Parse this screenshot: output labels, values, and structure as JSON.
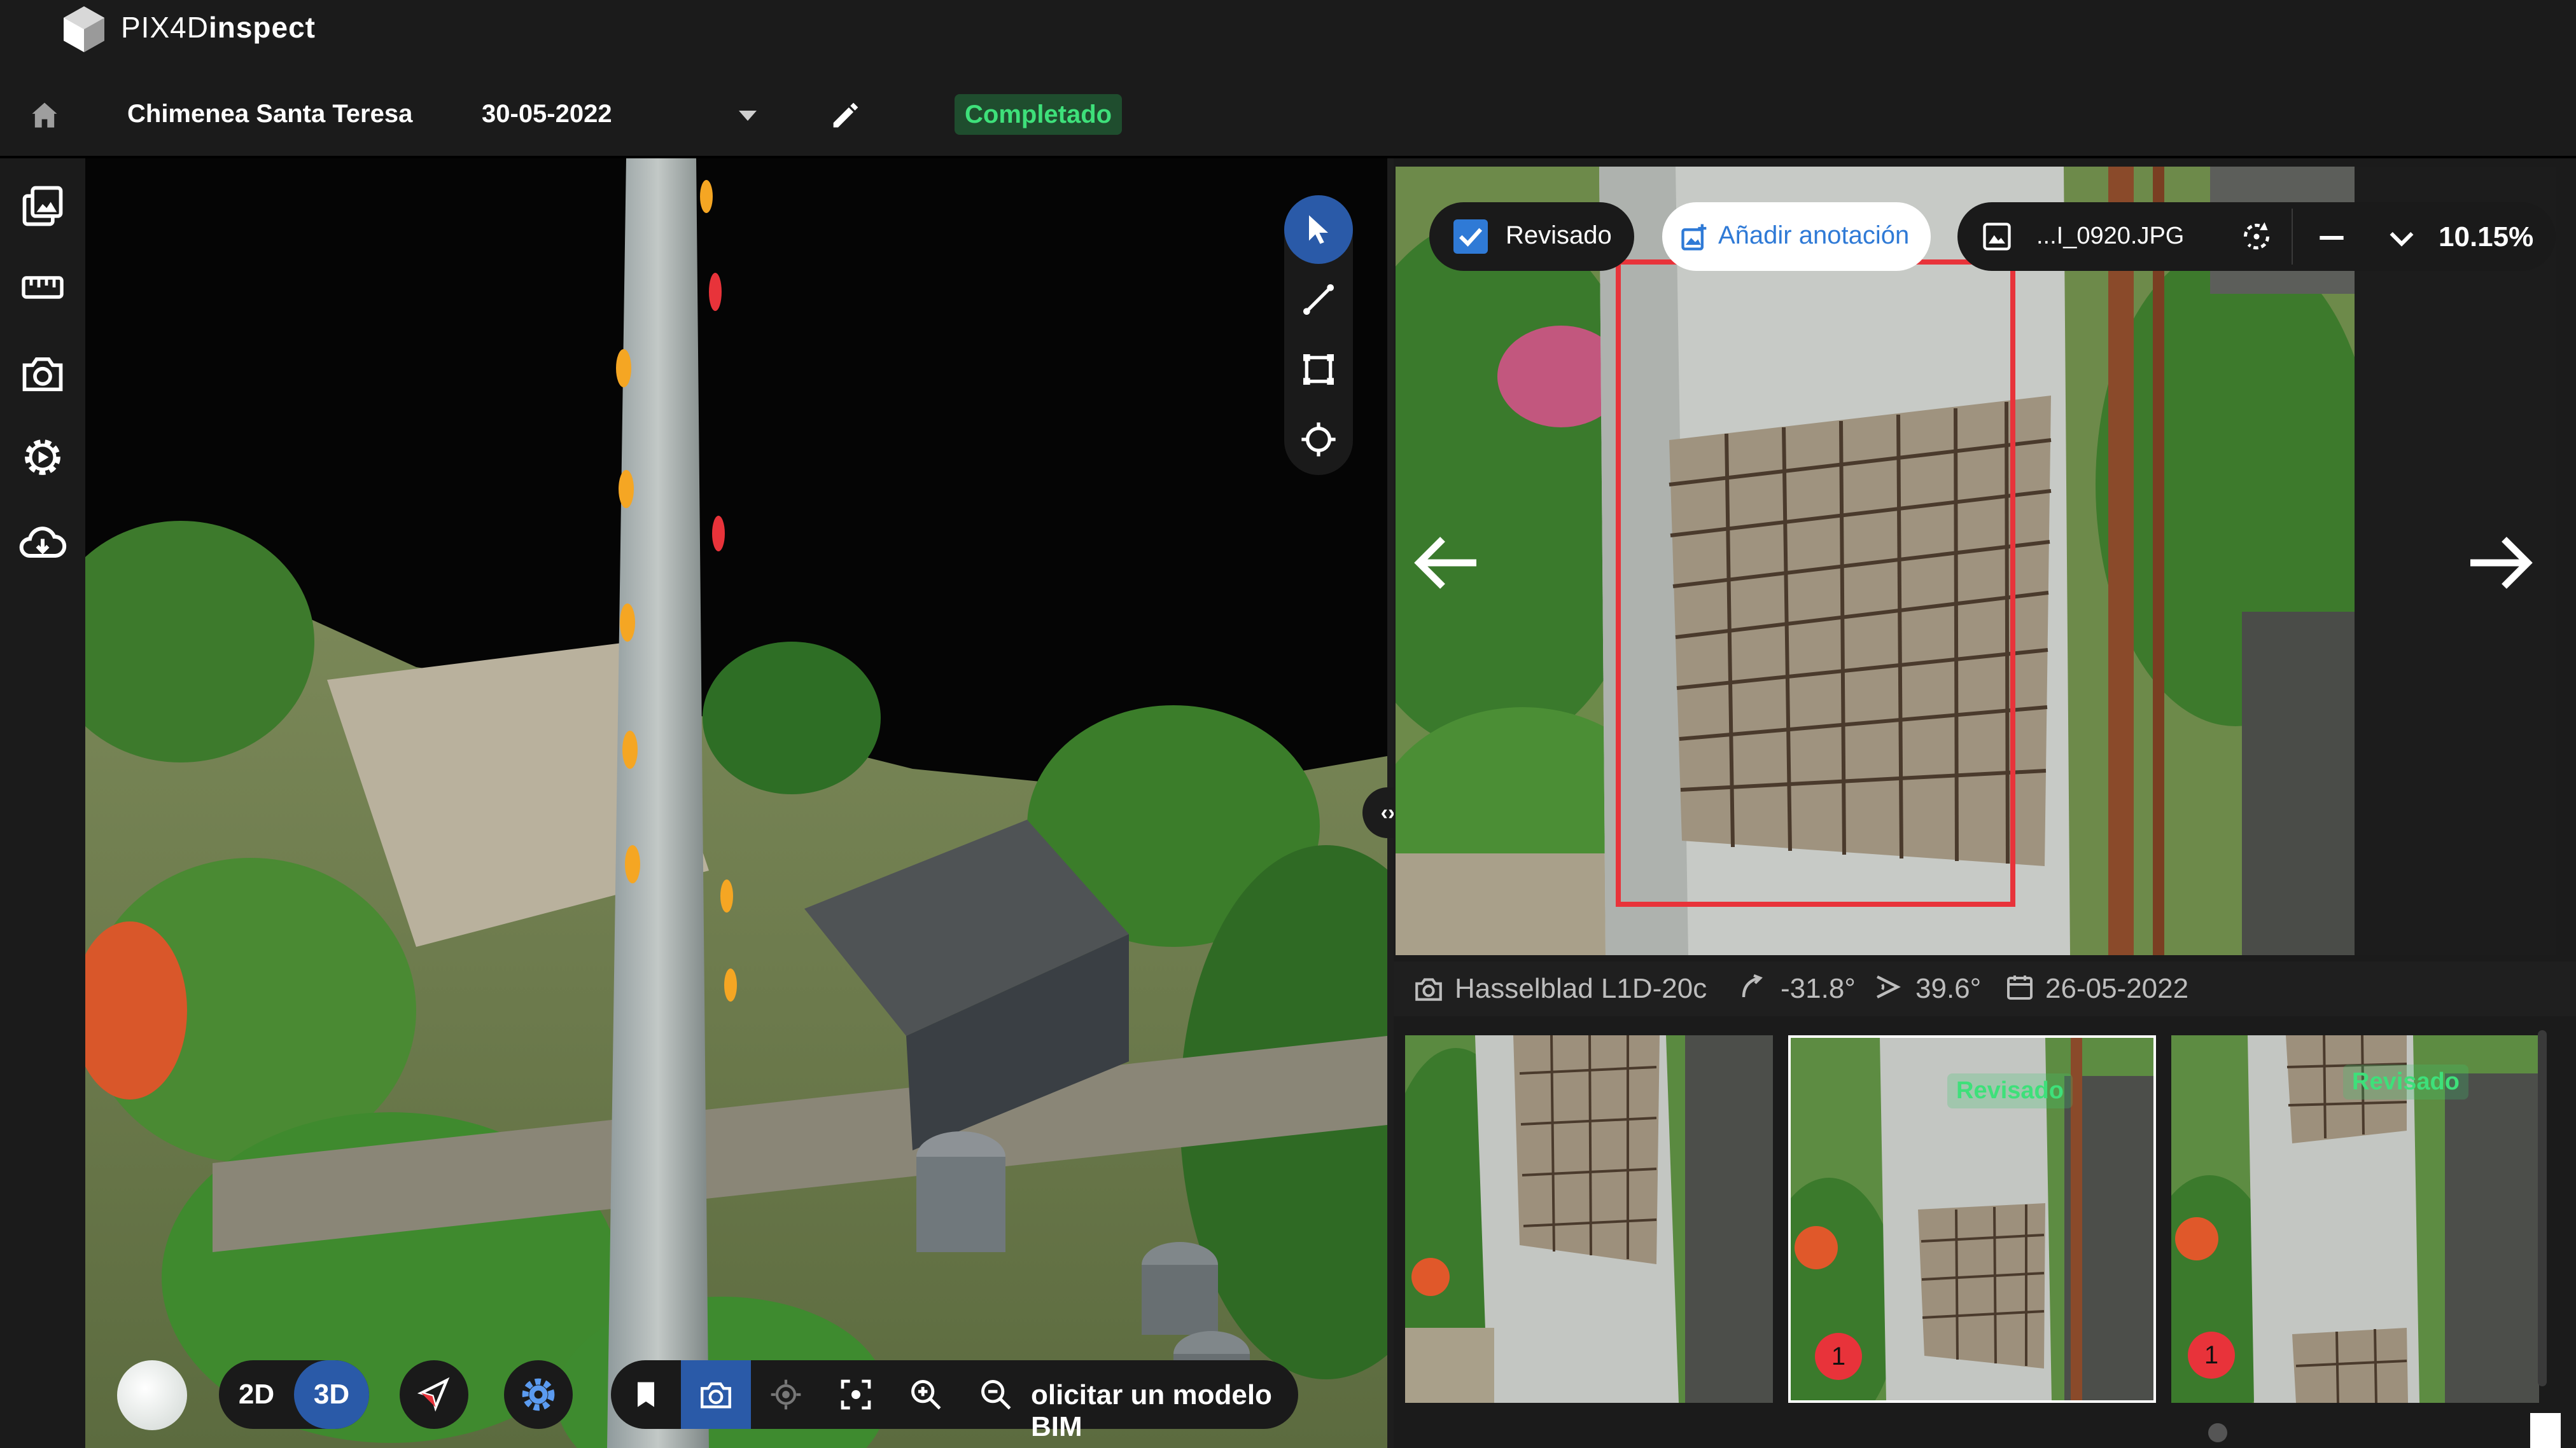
{
  "app": {
    "logo_text_light": "PIX4D",
    "logo_text_bold": "inspect"
  },
  "project": {
    "name": "Chimenea Santa Teresa",
    "date": "30-05-2022",
    "status": "Completado"
  },
  "photo_toolbar": {
    "reviewed_label": "Revisado",
    "add_annotation_label": "Añadir anotación",
    "filename": "...I_0920.JPG",
    "zoom": "10.15%"
  },
  "photo_meta": {
    "camera": "Hasselblad L1D-20c",
    "pitch": "-31.8°",
    "yaw": "39.6°",
    "date": "26-05-2022"
  },
  "thumbnails": [
    {
      "reviewed": "",
      "badge": ""
    },
    {
      "reviewed": "Revisado",
      "badge": "1"
    },
    {
      "reviewed": "Revisado",
      "badge": "1"
    }
  ],
  "viewer_toolbar": {
    "mode_2d": "2D",
    "mode_3d": "3D",
    "bim_request": "olicitar un modelo BIM"
  },
  "colors": {
    "accent_blue": "#2f6fd6",
    "status_green": "#3ee07a",
    "annotation_red": "#e8333a",
    "marker_orange": "#f5a623"
  },
  "icons": [
    "home-icon",
    "chevron-down-icon",
    "pencil-icon",
    "images-icon",
    "ruler-icon",
    "camera-icon",
    "gear-play-icon",
    "cloud-download-icon",
    "pointer-icon",
    "line-measure-icon",
    "area-measure-icon",
    "crosshair-icon",
    "arrow-left-icon",
    "arrow-right-icon",
    "zoom-out-icon",
    "zoom-in-icon",
    "bookmark-icon",
    "locate-icon",
    "focus-icon"
  ]
}
